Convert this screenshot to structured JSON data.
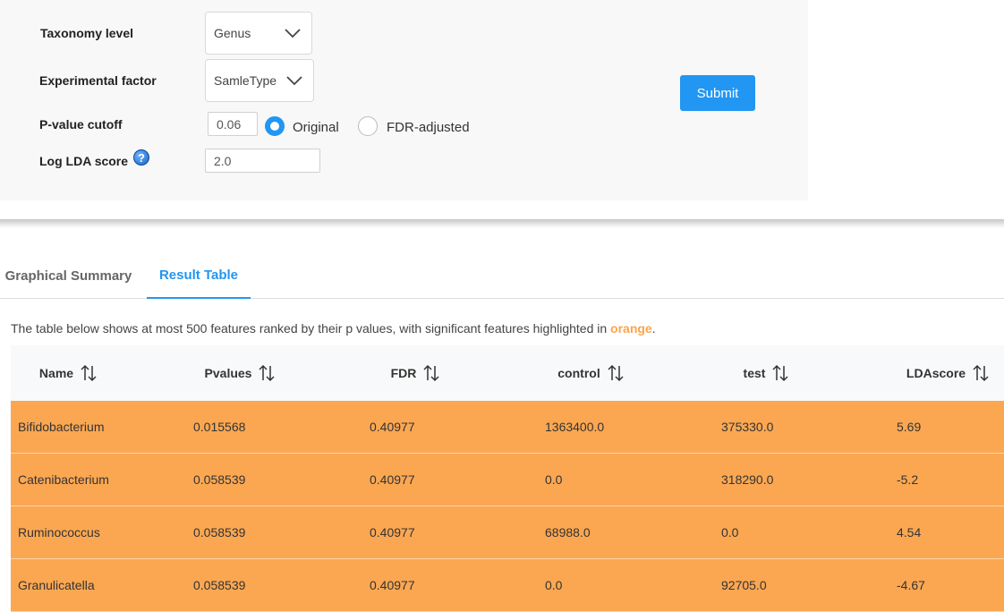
{
  "form": {
    "taxonomy": {
      "label": "Taxonomy level",
      "value": "Genus"
    },
    "factor": {
      "label": "Experimental factor",
      "value": "SamleType"
    },
    "pvalue": {
      "label": "P-value cutoff",
      "value": "0.06",
      "options": [
        {
          "label": "Original",
          "selected": true
        },
        {
          "label": "FDR-adjusted",
          "selected": false
        }
      ]
    },
    "lda": {
      "label": "Log LDA score",
      "value": "2.0",
      "help_icon": "?"
    },
    "submit_label": "Submit"
  },
  "tabs": [
    {
      "label": "Graphical Summary",
      "active": false
    },
    {
      "label": "Result Table",
      "active": true
    }
  ],
  "description": {
    "before": "The table below shows at most 500 features ranked by their p values, with significant features highlighted in ",
    "highlight": "orange",
    "after": "."
  },
  "table": {
    "columns": [
      "Name",
      "Pvalues",
      "FDR",
      "control",
      "test",
      "LDAscore"
    ],
    "highlight_color": "#fba752",
    "rows": [
      [
        "Bifidobacterium",
        "0.015568",
        "0.40977",
        "1363400.0",
        "375330.0",
        "5.69"
      ],
      [
        "Catenibacterium",
        "0.058539",
        "0.40977",
        "0.0",
        "318290.0",
        "-5.2"
      ],
      [
        "Ruminococcus",
        "0.058539",
        "0.40977",
        "68988.0",
        "0.0",
        "4.54"
      ],
      [
        "Granulicatella",
        "0.058539",
        "0.40977",
        "0.0",
        "92705.0",
        "-4.67"
      ]
    ]
  },
  "colors": {
    "accent": "#2196f3",
    "highlight": "#fba44c"
  }
}
